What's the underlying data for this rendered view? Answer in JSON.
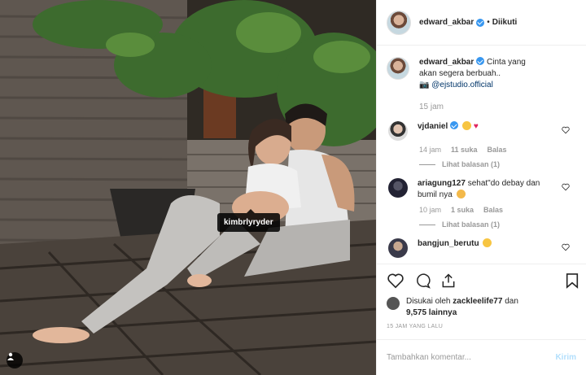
{
  "photo": {
    "tag_label": "kimbrlyryder"
  },
  "header": {
    "username": "edward_akbar",
    "separator": "•",
    "follow_status": "Diikuti"
  },
  "caption": {
    "username": "edward_akbar",
    "text": "Cinta yang akan segera berbuah..",
    "tag": "@ejstudio.official",
    "time": "15 jam"
  },
  "comments": [
    {
      "username": "vjdaniel",
      "text": "",
      "time": "14 jam",
      "likes": "11 suka",
      "reply": "Balas",
      "replies": "Lihat balasan (1)"
    },
    {
      "username": "ariagung127",
      "text": "sehat\"do debay dan bumil nya",
      "time": "10 jam",
      "likes": "1 suka",
      "reply": "Balas",
      "replies": "Lihat balasan (1)"
    },
    {
      "username": "bangjun_berutu",
      "text": ""
    }
  ],
  "likes": {
    "prefix": "Disukai oleh",
    "user": "zackleelife77",
    "joiner": "dan",
    "others": "9,575 lainnya"
  },
  "posted_ago": "15 JAM YANG LALU",
  "add_comment": {
    "placeholder": "Tambahkan komentar...",
    "post_label": "Kirim"
  },
  "colors": {
    "verified": "#3897f0",
    "link": "#003569",
    "muted": "#999999",
    "post_disabled": "#b2dffc"
  }
}
